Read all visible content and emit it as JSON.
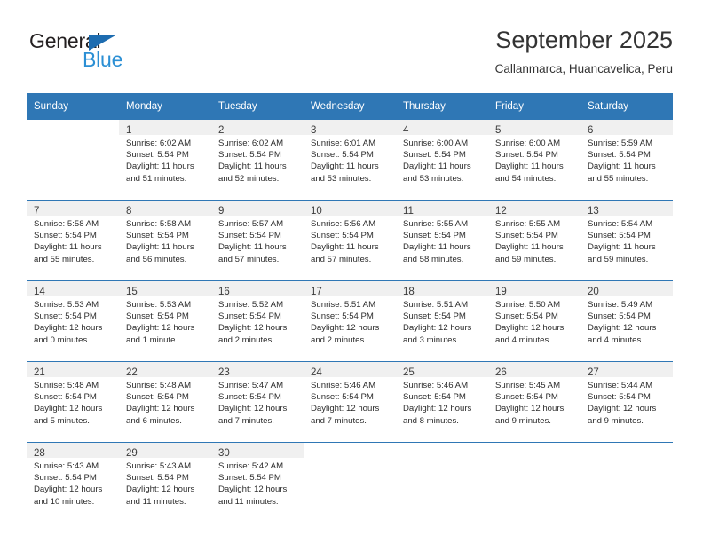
{
  "logo": {
    "word_dark": "General",
    "word_blue": "Blue",
    "triangle_color": "#1d6cb0",
    "blue_color": "#2b8fd4"
  },
  "header": {
    "title": "September 2025",
    "subtitle": "Callanmarca, Huancavelica, Peru"
  },
  "theme": {
    "header_blue": "#2f77b5",
    "daynum_band": "#f0f0f0",
    "separator_blue": "#2f77b5"
  },
  "weekdays": [
    "Sunday",
    "Monday",
    "Tuesday",
    "Wednesday",
    "Thursday",
    "Friday",
    "Saturday"
  ],
  "labels": {
    "sunrise_prefix": "Sunrise:",
    "sunset_prefix": "Sunset:",
    "daylight_prefix": "Daylight:"
  },
  "weeks": [
    [
      {
        "day": "",
        "sunrise": "",
        "sunset": "",
        "daylight_line1": "",
        "daylight_line2": ""
      },
      {
        "day": "1",
        "sunrise": "Sunrise: 6:02 AM",
        "sunset": "Sunset: 5:54 PM",
        "daylight_line1": "Daylight: 11 hours",
        "daylight_line2": "and 51 minutes."
      },
      {
        "day": "2",
        "sunrise": "Sunrise: 6:02 AM",
        "sunset": "Sunset: 5:54 PM",
        "daylight_line1": "Daylight: 11 hours",
        "daylight_line2": "and 52 minutes."
      },
      {
        "day": "3",
        "sunrise": "Sunrise: 6:01 AM",
        "sunset": "Sunset: 5:54 PM",
        "daylight_line1": "Daylight: 11 hours",
        "daylight_line2": "and 53 minutes."
      },
      {
        "day": "4",
        "sunrise": "Sunrise: 6:00 AM",
        "sunset": "Sunset: 5:54 PM",
        "daylight_line1": "Daylight: 11 hours",
        "daylight_line2": "and 53 minutes."
      },
      {
        "day": "5",
        "sunrise": "Sunrise: 6:00 AM",
        "sunset": "Sunset: 5:54 PM",
        "daylight_line1": "Daylight: 11 hours",
        "daylight_line2": "and 54 minutes."
      },
      {
        "day": "6",
        "sunrise": "Sunrise: 5:59 AM",
        "sunset": "Sunset: 5:54 PM",
        "daylight_line1": "Daylight: 11 hours",
        "daylight_line2": "and 55 minutes."
      }
    ],
    [
      {
        "day": "7",
        "sunrise": "Sunrise: 5:58 AM",
        "sunset": "Sunset: 5:54 PM",
        "daylight_line1": "Daylight: 11 hours",
        "daylight_line2": "and 55 minutes."
      },
      {
        "day": "8",
        "sunrise": "Sunrise: 5:58 AM",
        "sunset": "Sunset: 5:54 PM",
        "daylight_line1": "Daylight: 11 hours",
        "daylight_line2": "and 56 minutes."
      },
      {
        "day": "9",
        "sunrise": "Sunrise: 5:57 AM",
        "sunset": "Sunset: 5:54 PM",
        "daylight_line1": "Daylight: 11 hours",
        "daylight_line2": "and 57 minutes."
      },
      {
        "day": "10",
        "sunrise": "Sunrise: 5:56 AM",
        "sunset": "Sunset: 5:54 PM",
        "daylight_line1": "Daylight: 11 hours",
        "daylight_line2": "and 57 minutes."
      },
      {
        "day": "11",
        "sunrise": "Sunrise: 5:55 AM",
        "sunset": "Sunset: 5:54 PM",
        "daylight_line1": "Daylight: 11 hours",
        "daylight_line2": "and 58 minutes."
      },
      {
        "day": "12",
        "sunrise": "Sunrise: 5:55 AM",
        "sunset": "Sunset: 5:54 PM",
        "daylight_line1": "Daylight: 11 hours",
        "daylight_line2": "and 59 minutes."
      },
      {
        "day": "13",
        "sunrise": "Sunrise: 5:54 AM",
        "sunset": "Sunset: 5:54 PM",
        "daylight_line1": "Daylight: 11 hours",
        "daylight_line2": "and 59 minutes."
      }
    ],
    [
      {
        "day": "14",
        "sunrise": "Sunrise: 5:53 AM",
        "sunset": "Sunset: 5:54 PM",
        "daylight_line1": "Daylight: 12 hours",
        "daylight_line2": "and 0 minutes."
      },
      {
        "day": "15",
        "sunrise": "Sunrise: 5:53 AM",
        "sunset": "Sunset: 5:54 PM",
        "daylight_line1": "Daylight: 12 hours",
        "daylight_line2": "and 1 minute."
      },
      {
        "day": "16",
        "sunrise": "Sunrise: 5:52 AM",
        "sunset": "Sunset: 5:54 PM",
        "daylight_line1": "Daylight: 12 hours",
        "daylight_line2": "and 2 minutes."
      },
      {
        "day": "17",
        "sunrise": "Sunrise: 5:51 AM",
        "sunset": "Sunset: 5:54 PM",
        "daylight_line1": "Daylight: 12 hours",
        "daylight_line2": "and 2 minutes."
      },
      {
        "day": "18",
        "sunrise": "Sunrise: 5:51 AM",
        "sunset": "Sunset: 5:54 PM",
        "daylight_line1": "Daylight: 12 hours",
        "daylight_line2": "and 3 minutes."
      },
      {
        "day": "19",
        "sunrise": "Sunrise: 5:50 AM",
        "sunset": "Sunset: 5:54 PM",
        "daylight_line1": "Daylight: 12 hours",
        "daylight_line2": "and 4 minutes."
      },
      {
        "day": "20",
        "sunrise": "Sunrise: 5:49 AM",
        "sunset": "Sunset: 5:54 PM",
        "daylight_line1": "Daylight: 12 hours",
        "daylight_line2": "and 4 minutes."
      }
    ],
    [
      {
        "day": "21",
        "sunrise": "Sunrise: 5:48 AM",
        "sunset": "Sunset: 5:54 PM",
        "daylight_line1": "Daylight: 12 hours",
        "daylight_line2": "and 5 minutes."
      },
      {
        "day": "22",
        "sunrise": "Sunrise: 5:48 AM",
        "sunset": "Sunset: 5:54 PM",
        "daylight_line1": "Daylight: 12 hours",
        "daylight_line2": "and 6 minutes."
      },
      {
        "day": "23",
        "sunrise": "Sunrise: 5:47 AM",
        "sunset": "Sunset: 5:54 PM",
        "daylight_line1": "Daylight: 12 hours",
        "daylight_line2": "and 7 minutes."
      },
      {
        "day": "24",
        "sunrise": "Sunrise: 5:46 AM",
        "sunset": "Sunset: 5:54 PM",
        "daylight_line1": "Daylight: 12 hours",
        "daylight_line2": "and 7 minutes."
      },
      {
        "day": "25",
        "sunrise": "Sunrise: 5:46 AM",
        "sunset": "Sunset: 5:54 PM",
        "daylight_line1": "Daylight: 12 hours",
        "daylight_line2": "and 8 minutes."
      },
      {
        "day": "26",
        "sunrise": "Sunrise: 5:45 AM",
        "sunset": "Sunset: 5:54 PM",
        "daylight_line1": "Daylight: 12 hours",
        "daylight_line2": "and 9 minutes."
      },
      {
        "day": "27",
        "sunrise": "Sunrise: 5:44 AM",
        "sunset": "Sunset: 5:54 PM",
        "daylight_line1": "Daylight: 12 hours",
        "daylight_line2": "and 9 minutes."
      }
    ],
    [
      {
        "day": "28",
        "sunrise": "Sunrise: 5:43 AM",
        "sunset": "Sunset: 5:54 PM",
        "daylight_line1": "Daylight: 12 hours",
        "daylight_line2": "and 10 minutes."
      },
      {
        "day": "29",
        "sunrise": "Sunrise: 5:43 AM",
        "sunset": "Sunset: 5:54 PM",
        "daylight_line1": "Daylight: 12 hours",
        "daylight_line2": "and 11 minutes."
      },
      {
        "day": "30",
        "sunrise": "Sunrise: 5:42 AM",
        "sunset": "Sunset: 5:54 PM",
        "daylight_line1": "Daylight: 12 hours",
        "daylight_line2": "and 11 minutes."
      },
      {
        "day": "",
        "sunrise": "",
        "sunset": "",
        "daylight_line1": "",
        "daylight_line2": ""
      },
      {
        "day": "",
        "sunrise": "",
        "sunset": "",
        "daylight_line1": "",
        "daylight_line2": ""
      },
      {
        "day": "",
        "sunrise": "",
        "sunset": "",
        "daylight_line1": "",
        "daylight_line2": ""
      },
      {
        "day": "",
        "sunrise": "",
        "sunset": "",
        "daylight_line1": "",
        "daylight_line2": ""
      }
    ]
  ]
}
